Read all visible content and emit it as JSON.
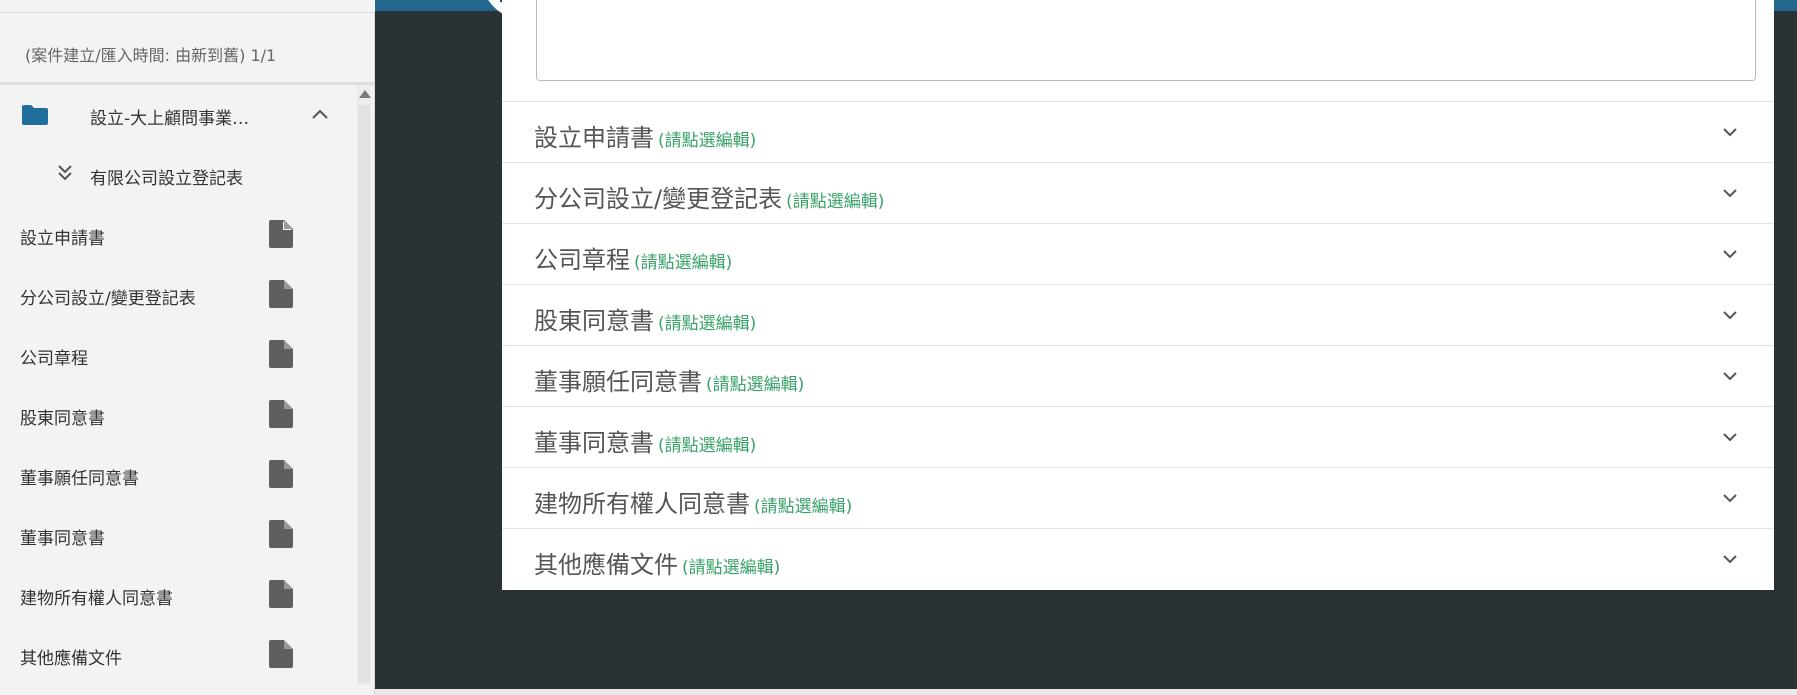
{
  "sidebar": {
    "sort_label": "(案件建立/匯入時間: 由新到舊) 1/1",
    "folder": {
      "label": "設立-大上顧問事業…",
      "icon": "folder-icon",
      "icon_color": "#1f6e9c",
      "toggle_icon": "chevron-up-icon"
    },
    "subfolder": {
      "label": "有限公司設立登記表",
      "icon": "double-chevron-down-icon"
    },
    "documents": [
      {
        "label": "設立申請書",
        "icon": "file-icon"
      },
      {
        "label": "分公司設立/變更登記表",
        "icon": "file-icon"
      },
      {
        "label": "公司章程",
        "icon": "file-icon"
      },
      {
        "label": "股東同意書",
        "icon": "file-icon"
      },
      {
        "label": "董事願任同意書",
        "icon": "file-icon"
      },
      {
        "label": "董事同意書",
        "icon": "file-icon"
      },
      {
        "label": "建物所有權人同意書",
        "icon": "file-icon"
      },
      {
        "label": "其他應備文件",
        "icon": "file-icon"
      }
    ]
  },
  "main": {
    "accordion": [
      {
        "title": "設立申請書",
        "hint": "(請點選編輯)"
      },
      {
        "title": "分公司設立/變更登記表",
        "hint": "(請點選編輯)"
      },
      {
        "title": "公司章程",
        "hint": "(請點選編輯)"
      },
      {
        "title": "股東同意書",
        "hint": "(請點選編輯)"
      },
      {
        "title": "董事願任同意書",
        "hint": "(請點選編輯)"
      },
      {
        "title": "董事同意書",
        "hint": "(請點選編輯)"
      },
      {
        "title": "建物所有權人同意書",
        "hint": "(請點選編輯)"
      },
      {
        "title": "其他應備文件",
        "hint": "(請點選編輯)"
      }
    ]
  },
  "colors": {
    "topbar": "#23678f",
    "hint_green": "#3aa36a",
    "background_dark": "#2a3236",
    "sidebar_bg": "#f3f3f3"
  }
}
